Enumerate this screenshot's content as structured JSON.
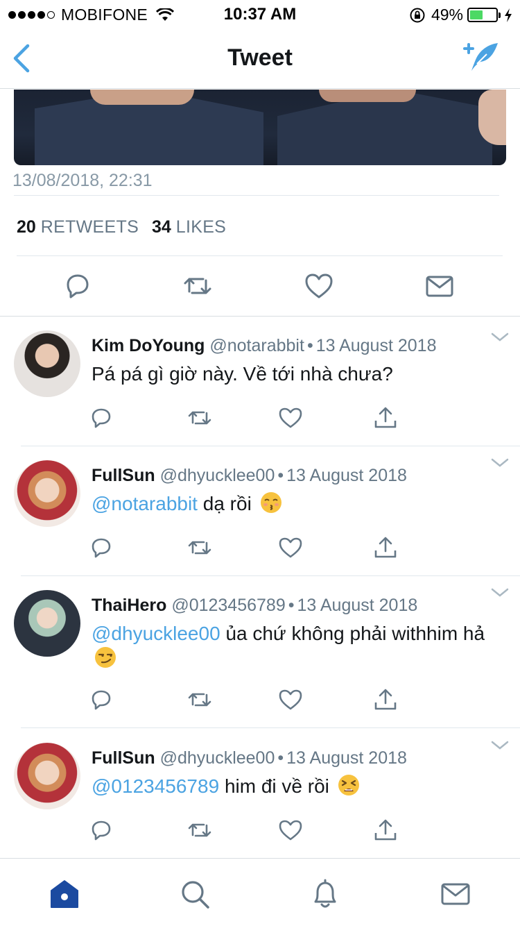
{
  "status_bar": {
    "carrier": "MOBIFONE",
    "time": "10:37 AM",
    "battery_percent": "49%",
    "battery_level": 0.49,
    "battery_color": "#4cd964"
  },
  "nav": {
    "title": "Tweet",
    "back_icon": "chevron-left-icon",
    "compose_icon": "compose-feather-icon"
  },
  "tweet": {
    "timestamp": "13/08/2018, 22:31",
    "retweets_count": "20",
    "retweets_label": "RETWEETS",
    "likes_count": "34",
    "likes_label": "LIKES",
    "actions": [
      "reply-icon",
      "retweet-icon",
      "like-icon",
      "message-icon"
    ]
  },
  "replies": [
    {
      "name": "Kim DoYoung",
      "handle": "@notarabbit",
      "date": "13 August 2018",
      "mention": "",
      "text": "Pá pá gì giờ này. Về tới nhà chưa?",
      "emoji": ""
    },
    {
      "name": "FullSun",
      "handle": "@dhyucklee00",
      "date": "13 August 2018",
      "mention": "@notarabbit",
      "text": "dạ rồi",
      "emoji": "kissing-face"
    },
    {
      "name": "ThaiHero",
      "handle": "@0123456789",
      "date": "13 August 2018",
      "mention": "@dhyucklee00",
      "text": "ủa chứ không phải withhim hả",
      "emoji": "smirking-face"
    },
    {
      "name": "FullSun",
      "handle": "@dhyucklee00",
      "date": "13 August 2018",
      "mention": "@0123456789",
      "text": "him đi về rồi",
      "emoji": "tired-face"
    }
  ],
  "tab_bar": {
    "items": [
      "home-icon",
      "search-icon",
      "notifications-icon",
      "messages-icon"
    ],
    "active": "home-icon",
    "accent": "#1da1f2",
    "active_color": "#1b4aa0"
  },
  "colors": {
    "link": "#4ba3e2",
    "text": "#14171a",
    "muted": "#657786",
    "icon": "#657786"
  }
}
